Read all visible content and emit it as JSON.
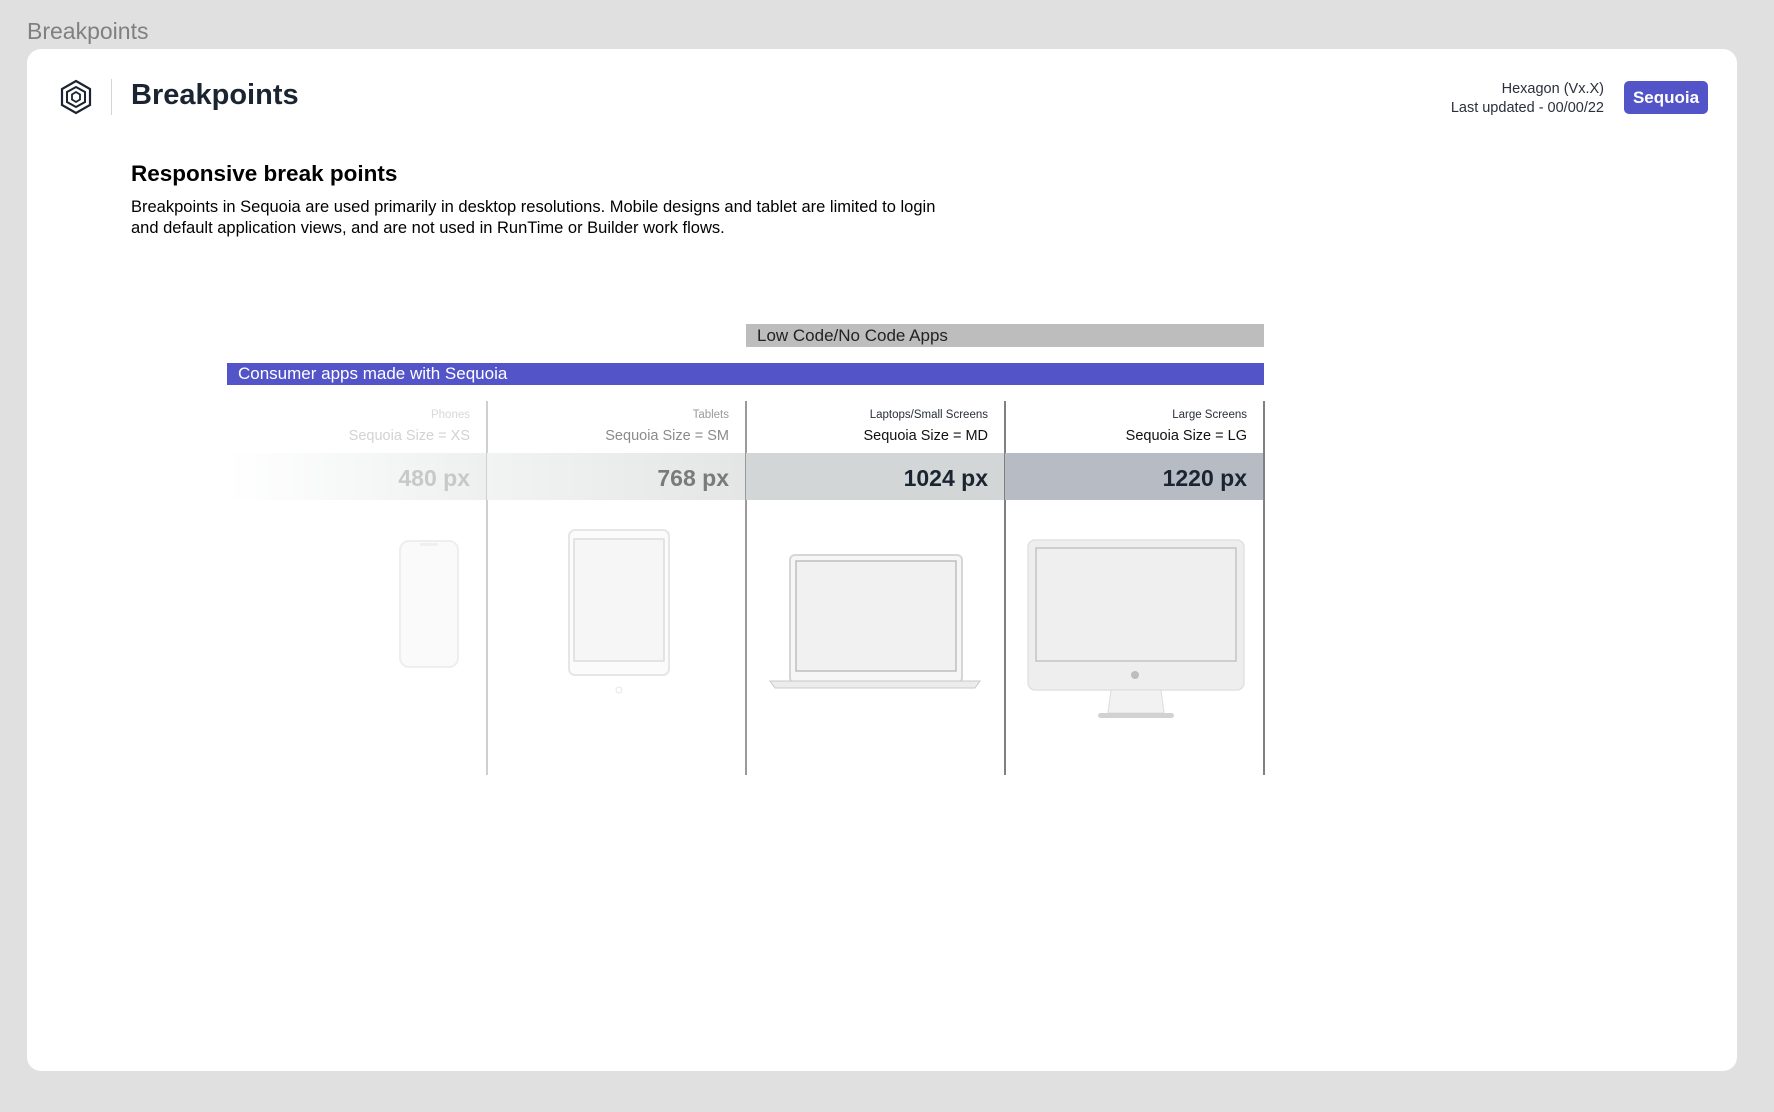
{
  "frame_label": "Breakpoints",
  "header": {
    "title": "Breakpoints",
    "version": "Hexagon (Vx.X)",
    "last_updated": "Last updated - 00/00/22",
    "badge": "Sequoia",
    "logo_icon": "hexagon-logo-icon",
    "accent_color": "#5254c8"
  },
  "section": {
    "heading": "Responsive break points",
    "description": "Breakpoints in Sequoia are used primarily in desktop resolutions. Mobile designs and tablet are limited to login and default application views, and are not used in RunTime or Builder work flows."
  },
  "bars": {
    "low_code": "Low Code/No Code Apps",
    "consumer": "Consumer apps made with Sequoia"
  },
  "breakpoints": [
    {
      "category": "Phones",
      "size": "Sequoia Size = XS",
      "px": "480 px",
      "device_icon": "phone-icon"
    },
    {
      "category": "Tablets",
      "size": "Sequoia Size = SM",
      "px": "768 px",
      "device_icon": "tablet-icon"
    },
    {
      "category": "Laptops/Small Screens",
      "size": "Sequoia Size = MD",
      "px": "1024 px",
      "device_icon": "laptop-icon"
    },
    {
      "category": "Large Screens",
      "size": "Sequoia Size = LG",
      "px": "1220 px",
      "device_icon": "desktop-monitor-icon"
    }
  ]
}
